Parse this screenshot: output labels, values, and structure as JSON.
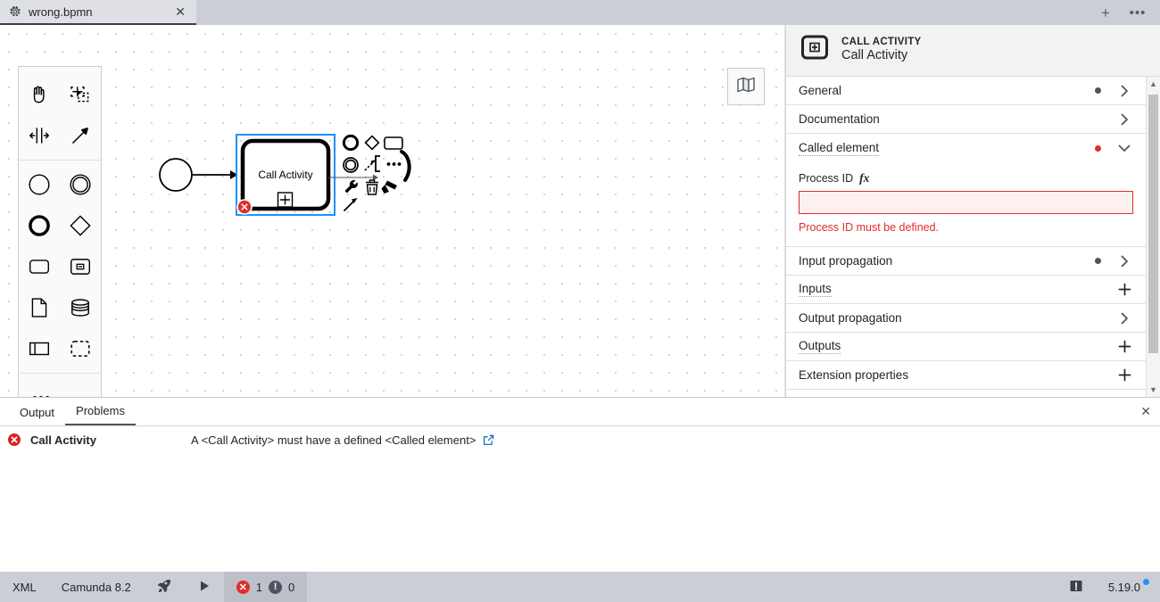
{
  "window": {
    "tab": {
      "icon": "gear-icon",
      "title": "wrong.bpmn",
      "close_label": "✕"
    },
    "actions": {
      "new_tab_label": "+",
      "more_label": "•••"
    }
  },
  "canvas": {
    "minimap_toggle_name": "map-icon",
    "palette": {
      "groups": [
        {
          "items": [
            {
              "name": "hand-tool-icon",
              "label": "Activate the hand tool"
            },
            {
              "name": "lasso-tool-icon",
              "label": "Activate the lasso tool"
            },
            {
              "name": "space-tool-icon",
              "label": "Activate the create/remove space tool"
            },
            {
              "name": "global-connect-tool-icon",
              "label": "Activate the global connect tool"
            }
          ]
        },
        {
          "items": [
            {
              "name": "start-event-icon",
              "label": "Create StartEvent"
            },
            {
              "name": "intermediate-event-icon",
              "label": "Create Intermediate/Boundary Event"
            },
            {
              "name": "end-event-icon",
              "label": "Create EndEvent"
            },
            {
              "name": "gateway-icon",
              "label": "Create Gateway"
            },
            {
              "name": "task-icon",
              "label": "Create Task"
            },
            {
              "name": "subprocess-expanded-icon",
              "label": "Create expanded SubProcess"
            },
            {
              "name": "data-object-icon",
              "label": "Create DataObjectReference"
            },
            {
              "name": "data-store-icon",
              "label": "Create DataStoreReference"
            },
            {
              "name": "participant-icon",
              "label": "Create Pool/Participant"
            },
            {
              "name": "group-icon",
              "label": "Create Group"
            }
          ]
        },
        {
          "items": [
            {
              "name": "more-palette-icon",
              "label": "•••"
            }
          ]
        }
      ]
    },
    "elements": {
      "start_event": {
        "name": "start-event-shape"
      },
      "sequence_flow": {
        "name": "sequence-flow-connection"
      },
      "call_activity": {
        "name": "call-activity-shape",
        "label": "Call Activity",
        "marker": "call-activity-marker-icon",
        "selected": true,
        "error_badge": "error-badge-icon"
      }
    },
    "context_pad": {
      "items": [
        {
          "name": "append-end-event-icon"
        },
        {
          "name": "append-gateway-icon"
        },
        {
          "name": "append-task-icon"
        },
        {
          "name": "append-intermediate-event-icon"
        },
        {
          "name": "append-text-annotation-icon"
        },
        {
          "name": "change-type-icon"
        },
        {
          "name": "connect-icon"
        },
        {
          "name": "wrench-icon"
        },
        {
          "name": "delete-icon"
        },
        {
          "name": "set-color-icon"
        },
        {
          "name": "append-connect-arrow-icon"
        },
        {
          "name": "loop-marker-icon"
        }
      ]
    }
  },
  "properties_panel": {
    "header": {
      "icon": "call-activity-icon",
      "type": "CALL ACTIVITY",
      "title": "Call Activity"
    },
    "groups": [
      {
        "label": "General",
        "indicator": "grey",
        "toggle": "chevron-right-icon",
        "expanded": false
      },
      {
        "label": "Documentation",
        "indicator": "none",
        "toggle": "chevron-right-icon",
        "expanded": false
      },
      {
        "label": "Called element",
        "indicator": "red",
        "toggle": "chevron-down-icon",
        "expanded": true,
        "dotted_underline": true
      },
      {
        "label": "Input propagation",
        "indicator": "grey",
        "toggle": "chevron-right-icon",
        "expanded": false
      },
      {
        "label": "Inputs",
        "indicator": "none",
        "toggle": "plus-icon",
        "expanded": false,
        "dotted_underline": true
      },
      {
        "label": "Output propagation",
        "indicator": "none",
        "toggle": "chevron-right-icon",
        "expanded": false
      },
      {
        "label": "Outputs",
        "indicator": "none",
        "toggle": "plus-icon",
        "expanded": false,
        "dotted_underline": true
      },
      {
        "label": "Extension properties",
        "indicator": "none",
        "toggle": "plus-icon",
        "expanded": false
      }
    ],
    "called_element": {
      "field_label": "Process ID",
      "fx_label": "fx",
      "value": "",
      "placeholder": "",
      "error": "Process ID must be defined."
    },
    "indicator_colors": {
      "grey": "#4d5562",
      "red": "#e32c28"
    }
  },
  "problems_panel": {
    "tabs": [
      {
        "label": "Output",
        "active": false
      },
      {
        "label": "Problems",
        "active": true
      }
    ],
    "close_label": "✕",
    "rows": [
      {
        "severity": "error",
        "icon": "error-icon",
        "element": "Call Activity",
        "message": "A <Call Activity> must have a defined <Called element>",
        "link_icon": "external-link-icon"
      }
    ]
  },
  "status_bar": {
    "left_items": [
      {
        "name": "xml-toggle",
        "label": "XML",
        "icon": "none"
      },
      {
        "name": "engine-version",
        "label": "Camunda 8.2",
        "icon": "none"
      },
      {
        "name": "deploy-button",
        "label": "",
        "icon": "rocket-icon"
      },
      {
        "name": "run-button",
        "label": "",
        "icon": "play-icon"
      }
    ],
    "problem_counts": {
      "errors": "1",
      "warnings": "0",
      "error_color": "#e32c28",
      "warning_color": "#4d5562"
    },
    "right_items": [
      {
        "name": "notifications-button",
        "icon": "notification-icon",
        "label": ""
      },
      {
        "name": "app-version",
        "icon": "none",
        "label": "5.19.0",
        "update_dot": true
      }
    ]
  }
}
